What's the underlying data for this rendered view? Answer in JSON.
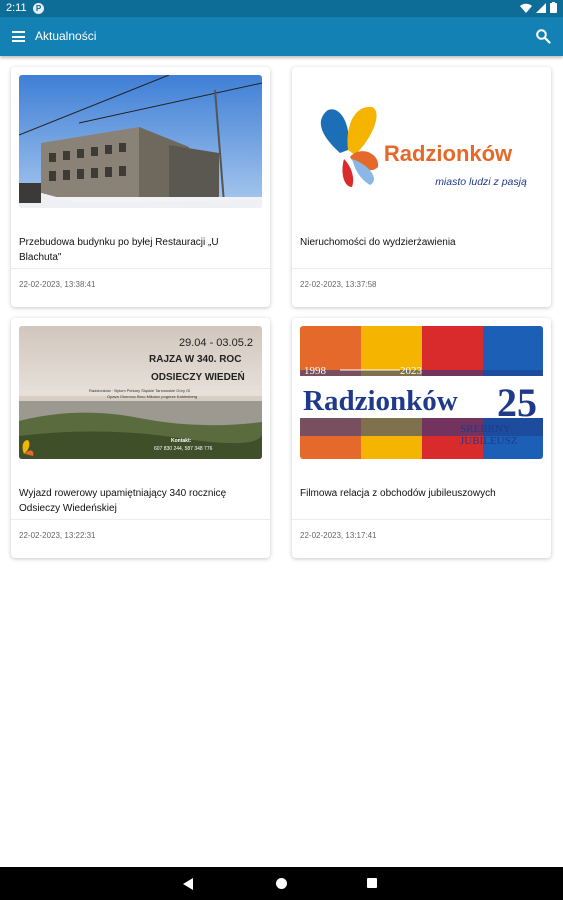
{
  "status_bar": {
    "time": "2:11",
    "notification_letter": "P"
  },
  "app_bar": {
    "title": "Aktualności"
  },
  "news": [
    {
      "title": "Przebudowa budynku po byłej Restauracji „U Blachuta\"",
      "date": "22-02-2023, 13:38:41"
    },
    {
      "title": "Nieruchomości do wydzierżawienia",
      "date": "22-02-2023, 13:37:58"
    },
    {
      "title": "Wyjazd rowerowy upamiętniający 340 rocznicę Odsieczy Wiedeńskiej",
      "date": "22-02-2023, 13:22:31"
    },
    {
      "title": "Filmowa relacja z obchodów jubileuszowych",
      "date": "22-02-2023, 13:17:41"
    }
  ],
  "images": {
    "logo": {
      "name": "Radzionków",
      "tagline": "miasto ludzi z pasją"
    },
    "poster": {
      "dates": "29.04 - 03.05.2",
      "line1": "RAJZA W 340. ROC",
      "line2": "ODSIECZY WIEDEŃ",
      "route": "Radzionków · Bytom Piekary Śląskie Tarnowskie Góry Gl",
      "route2": "Opava Olomouc Brno Mikulov pogórze Kahlenberg",
      "contact_label": "Kontakt:",
      "contact": "607 830 244, 587 348 776"
    },
    "jubilee": {
      "years_start": "1998",
      "years_end": "2023",
      "name": "Radzionków",
      "number": "25",
      "sub1": "SREBRNY",
      "sub2": "JUBILEUSZ"
    }
  },
  "icons": {
    "menu": "menu-icon",
    "search": "search-icon",
    "back": "back-icon",
    "home": "home-icon",
    "recents": "recents-icon"
  },
  "colors": {
    "app_bar": "#1381b4",
    "status_bar": "#0e6d96",
    "brand_orange": "#e5692a",
    "brand_blue": "#1f3a8a"
  }
}
